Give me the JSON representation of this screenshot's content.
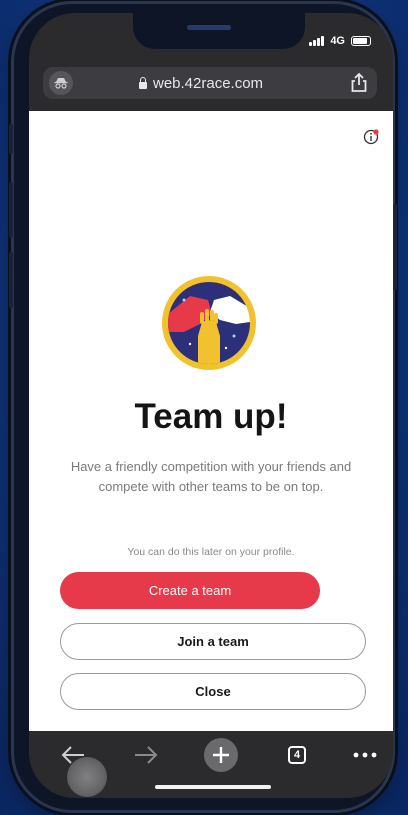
{
  "status_bar": {
    "network": "4G"
  },
  "browser": {
    "url": "web.42race.com",
    "open_tabs": "4"
  },
  "page": {
    "title": "Team up!",
    "description": "Have a friendly competition with your friends and compete with other teams to be on top.",
    "later_note": "You can do this later on your profile.",
    "buttons": {
      "create": "Create a team",
      "join": "Join a team",
      "close": "Close"
    }
  },
  "colors": {
    "accent_red": "#e6394a",
    "badge_navy": "#2c2f7a",
    "badge_gold": "#f2c12e"
  },
  "icons": [
    "incognito-icon",
    "lock-icon",
    "share-icon",
    "info-icon",
    "back-arrow-icon",
    "forward-arrow-icon",
    "plus-icon",
    "tabs-icon",
    "more-icon"
  ]
}
